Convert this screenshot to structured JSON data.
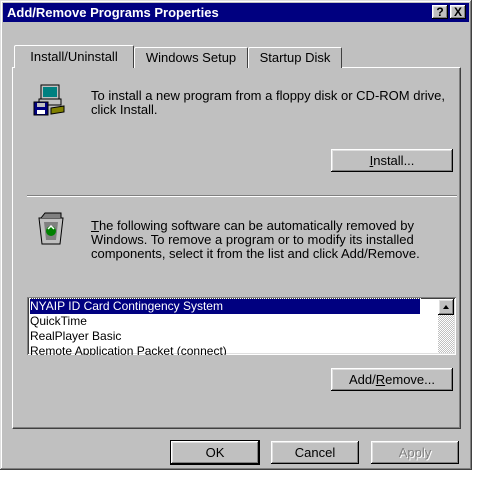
{
  "window": {
    "title": "Add/Remove Programs Properties",
    "help_label": "?",
    "close_label": "X"
  },
  "tabs": [
    {
      "label": "Install/Uninstall",
      "active": true
    },
    {
      "label": "Windows Setup",
      "active": false
    },
    {
      "label": "Startup Disk",
      "active": false
    }
  ],
  "install": {
    "description": "To install a new program from a floppy disk or CD-ROM drive, click Install.",
    "button_prefix": "",
    "button_mnemonic": "I",
    "button_suffix": "nstall..."
  },
  "uninstall": {
    "desc_mnemonic": "T",
    "desc_rest": "he following software can be automatically removed by Windows. To remove a program or to modify its installed components, select it from the list and click Add/Remove.",
    "programs": [
      "NYAIP ID Card Contingency System",
      "QuickTime",
      "RealPlayer Basic",
      "Remote Application Packet (connect)"
    ],
    "selected_index": 0,
    "button_prefix": "Add/",
    "button_mnemonic": "R",
    "button_suffix": "emove..."
  },
  "footer": {
    "ok_label": "OK",
    "cancel_label": "Cancel",
    "apply_label": "Apply"
  }
}
